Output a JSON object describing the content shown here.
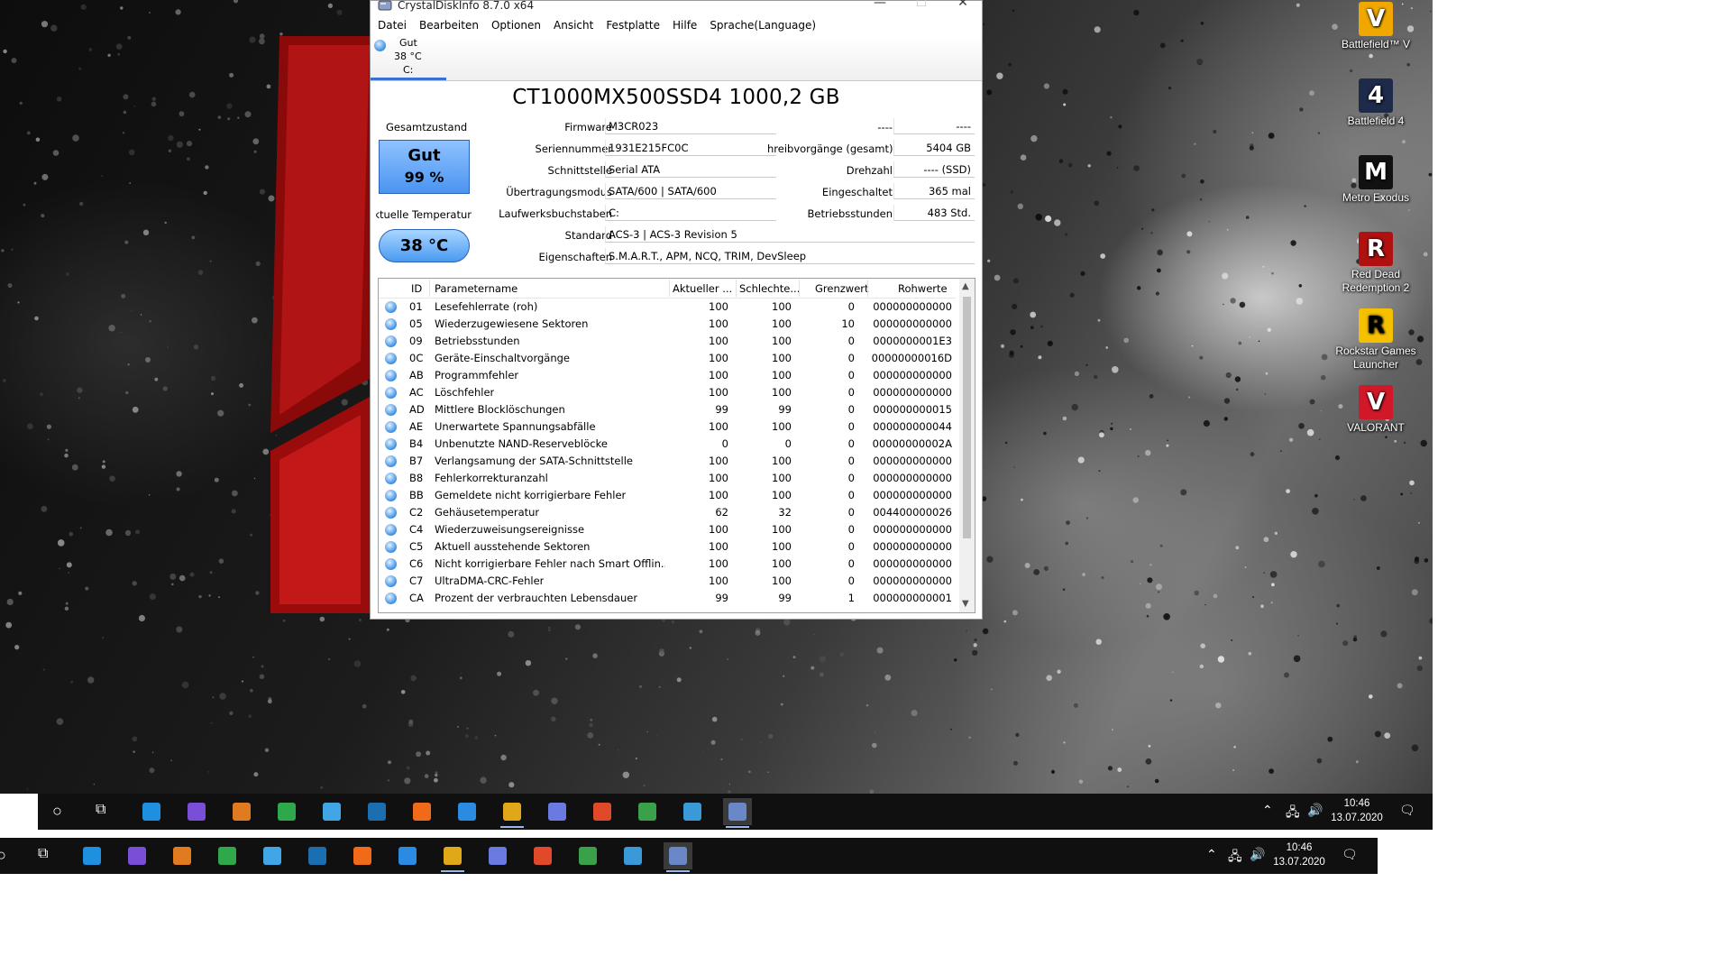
{
  "desktop": {
    "icons": [
      {
        "label": "Battlefield™ V",
        "glyph": "V",
        "bg": "#f0a800",
        "fg": "#ffffff",
        "icon": "battlefield-v-icon"
      },
      {
        "label": "Battlefield 4",
        "glyph": "4",
        "bg": "#1e2a4a",
        "fg": "#ffffff",
        "icon": "battlefield-4-icon"
      },
      {
        "label": "Metro Exodus",
        "glyph": "M",
        "bg": "#111111",
        "fg": "#ffffff",
        "icon": "metro-exodus-icon"
      },
      {
        "label": "Red Dead Redemption 2",
        "glyph": "R",
        "bg": "#b01010",
        "fg": "#ffffff",
        "icon": "red-dead-icon"
      },
      {
        "label": "Rockstar Games Launcher",
        "glyph": "R",
        "bg": "#f5c000",
        "fg": "#000000",
        "icon": "rockstar-launcher-icon"
      },
      {
        "label": "VALORANT",
        "glyph": "V",
        "bg": "#d01828",
        "fg": "#ffffff",
        "icon": "valorant-icon"
      }
    ]
  },
  "window": {
    "title": "CrystalDiskInfo 8.7.0 x64",
    "controls": {
      "minimize": "—",
      "maximize": "☐",
      "close": "✕"
    },
    "menu": [
      "Datei",
      "Bearbeiten",
      "Optionen",
      "Ansicht",
      "Festplatte",
      "Hilfe",
      "Sprache(Language)"
    ],
    "disk_tab": {
      "status": "Gut",
      "temp": "38 °C",
      "drive": "C:"
    },
    "model": "CT1000MX500SSD4 1000,2 GB",
    "health": {
      "label": "Gesamtzustand",
      "status": "Gut",
      "percent": "99 %"
    },
    "temperature": {
      "label": "Aktuelle Temperatur",
      "value": "38 °C"
    },
    "info_left": {
      "firmware": {
        "label": "Firmware",
        "value": "M3CR023"
      },
      "serial": {
        "label": "Seriennummer",
        "value": "1931E215FC0C"
      },
      "interface": {
        "label": "Schnittstelle",
        "value": "Serial ATA"
      },
      "transfer": {
        "label": "Übertragungsmodus",
        "value": "SATA/600 | SATA/600"
      },
      "drive_letter": {
        "label": "Laufwerksbuchstaben",
        "value": "C:"
      },
      "standard": {
        "label": "Standard",
        "value": "ACS-3 | ACS-3 Revision 5"
      },
      "features": {
        "label": "Eigenschaften",
        "value": "S.M.A.R.T., APM, NCQ, TRIM, DevSleep"
      }
    },
    "info_right": {
      "r1": {
        "label": "----",
        "value": "----"
      },
      "writes": {
        "label": "hreibvorgänge (gesamt)",
        "value": "5404 GB"
      },
      "rpm": {
        "label": "Drehzahl",
        "value": "---- (SSD)"
      },
      "power_on_count": {
        "label": "Eingeschaltet",
        "value": "365 mal"
      },
      "power_on_hours": {
        "label": "Betriebsstunden",
        "value": "483 Std."
      }
    },
    "smart": {
      "headers": {
        "id": "ID",
        "name": "Parametername",
        "current": "Aktueller ...",
        "worst": "Schlechte...",
        "threshold": "Grenzwert",
        "raw": "Rohwerte"
      },
      "rows": [
        {
          "id": "01",
          "name": "Lesefehlerrate (roh)",
          "current": "100",
          "worst": "100",
          "threshold": "0",
          "raw": "000000000000"
        },
        {
          "id": "05",
          "name": "Wiederzugewiesene Sektoren",
          "current": "100",
          "worst": "100",
          "threshold": "10",
          "raw": "000000000000"
        },
        {
          "id": "09",
          "name": "Betriebsstunden",
          "current": "100",
          "worst": "100",
          "threshold": "0",
          "raw": "0000000001E3"
        },
        {
          "id": "0C",
          "name": "Geräte-Einschaltvorgänge",
          "current": "100",
          "worst": "100",
          "threshold": "0",
          "raw": "00000000016D"
        },
        {
          "id": "AB",
          "name": "Programmfehler",
          "current": "100",
          "worst": "100",
          "threshold": "0",
          "raw": "000000000000"
        },
        {
          "id": "AC",
          "name": "Löschfehler",
          "current": "100",
          "worst": "100",
          "threshold": "0",
          "raw": "000000000000"
        },
        {
          "id": "AD",
          "name": "Mittlere Blocklöschungen",
          "current": "99",
          "worst": "99",
          "threshold": "0",
          "raw": "000000000015"
        },
        {
          "id": "AE",
          "name": "Unerwartete Spannungsabfälle",
          "current": "100",
          "worst": "100",
          "threshold": "0",
          "raw": "000000000044"
        },
        {
          "id": "B4",
          "name": "Unbenutzte NAND-Reserveblöcke",
          "current": "0",
          "worst": "0",
          "threshold": "0",
          "raw": "00000000002A"
        },
        {
          "id": "B7",
          "name": "Verlangsamung der SATA-Schnittstelle",
          "current": "100",
          "worst": "100",
          "threshold": "0",
          "raw": "000000000000"
        },
        {
          "id": "B8",
          "name": "Fehlerkorrekturanzahl",
          "current": "100",
          "worst": "100",
          "threshold": "0",
          "raw": "000000000000"
        },
        {
          "id": "BB",
          "name": "Gemeldete nicht korrigierbare Fehler",
          "current": "100",
          "worst": "100",
          "threshold": "0",
          "raw": "000000000000"
        },
        {
          "id": "C2",
          "name": "Gehäusetemperatur",
          "current": "62",
          "worst": "32",
          "threshold": "0",
          "raw": "004400000026"
        },
        {
          "id": "C4",
          "name": "Wiederzuweisungsereignisse",
          "current": "100",
          "worst": "100",
          "threshold": "0",
          "raw": "000000000000"
        },
        {
          "id": "C5",
          "name": "Aktuell ausstehende Sektoren",
          "current": "100",
          "worst": "100",
          "threshold": "0",
          "raw": "000000000000"
        },
        {
          "id": "C6",
          "name": "Nicht korrigierbare Fehler nach Smart Offlin...",
          "current": "100",
          "worst": "100",
          "threshold": "0",
          "raw": "000000000000"
        },
        {
          "id": "C7",
          "name": "UltraDMA-CRC-Fehler",
          "current": "100",
          "worst": "100",
          "threshold": "0",
          "raw": "000000000000"
        },
        {
          "id": "CA",
          "name": "Prozent der verbrauchten Lebensdauer",
          "current": "99",
          "worst": "99",
          "threshold": "1",
          "raw": "000000000001"
        }
      ]
    }
  },
  "taskbar": {
    "apps": [
      {
        "name": "edge-icon",
        "color": "#1f8fe0"
      },
      {
        "name": "cpu-z-icon",
        "color": "#7b4ed8"
      },
      {
        "name": "office-icon",
        "color": "#e07b20"
      },
      {
        "name": "xbox-icon",
        "color": "#2ea84a"
      },
      {
        "name": "network-app-icon",
        "color": "#41a6e6"
      },
      {
        "name": "steam-icon",
        "color": "#1b6eb0"
      },
      {
        "name": "origin-icon",
        "color": "#f06a1a"
      },
      {
        "name": "battlenet-icon",
        "color": "#2a8be0"
      },
      {
        "name": "chrome-icon",
        "color": "#e0a818"
      },
      {
        "name": "obs-icon",
        "color": "#6a7ae0"
      },
      {
        "name": "media-app-icon",
        "color": "#e04a2a"
      },
      {
        "name": "photos-app-icon",
        "color": "#3aa04a"
      },
      {
        "name": "monitor-app-icon",
        "color": "#3a9ad8"
      },
      {
        "name": "crystaldiskinfo-icon",
        "color": "#6a88c8"
      }
    ],
    "time": "10:46",
    "date": "13.07.2020"
  }
}
